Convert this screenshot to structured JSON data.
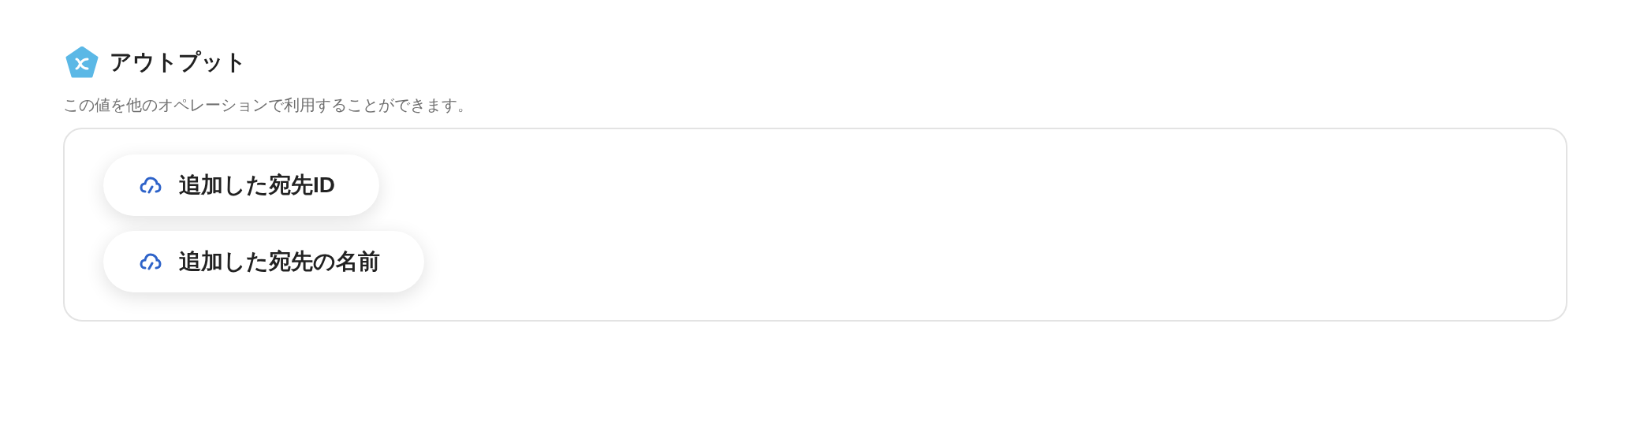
{
  "header": {
    "title": "アウトプット",
    "description": "この値を他のオペレーションで利用することができます。"
  },
  "outputs": [
    {
      "label": "追加した宛先ID"
    },
    {
      "label": "追加した宛先の名前"
    }
  ]
}
